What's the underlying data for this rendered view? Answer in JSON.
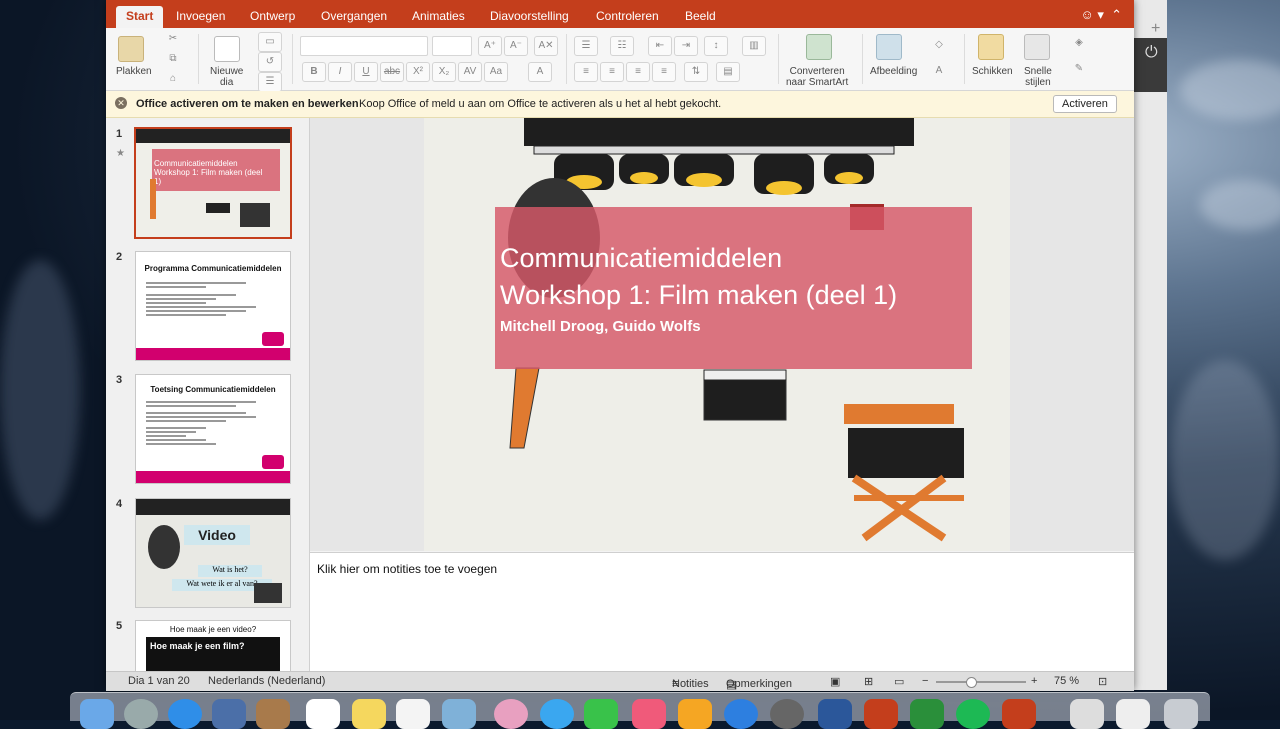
{
  "ribbon_tabs": [
    "Start",
    "Invoegen",
    "Ontwerp",
    "Overgangen",
    "Animaties",
    "Diavoorstelling",
    "Controleren",
    "Beeld"
  ],
  "ribbon": {
    "plakken": "Plakken",
    "nieuwe_dia_1": "Nieuwe",
    "nieuwe_dia_2": "dia",
    "converteren_1": "Converteren",
    "converteren_2": "naar SmartArt",
    "afbeelding": "Afbeelding",
    "schikken": "Schikken",
    "snelle_1": "Snelle",
    "snelle_2": "stijlen"
  },
  "message_bar": {
    "title": "Office activeren om te maken en bewerken",
    "text": "Koop Office of meld u aan om Office te activeren als u het al hebt gekocht.",
    "button": "Activeren"
  },
  "thumbnails": [
    {
      "num": "1",
      "title": "Communicatiemiddelen Workshop 1: Film maken (deel 1)"
    },
    {
      "num": "2",
      "title": "Programma Communicatiemiddelen"
    },
    {
      "num": "3",
      "title": "Toetsing Communicatiemiddelen"
    },
    {
      "num": "4",
      "title": "Video",
      "sub1": "Wat is het?",
      "sub2": "Wat wete ik er al van?"
    },
    {
      "num": "5",
      "title": "Hoe maak je een video?",
      "sub1": "Hoe maak je een film?"
    }
  ],
  "slide": {
    "title_line1": "Communicatiemiddelen",
    "title_line2": "Workshop 1: Film maken (deel 1)",
    "subtitle": "Mitchell Droog, Guido Wolfs"
  },
  "notes_placeholder": "Klik hier om notities toe te voegen",
  "status": {
    "slide_count": "Dia 1 van 20",
    "language": "Nederlands (Nederland)",
    "notes": "Notities",
    "comments": "Opmerkingen",
    "zoom": "75 %",
    "zoom_minus": "−",
    "zoom_plus": "+"
  },
  "colors": {
    "accent": "#c43e1c",
    "pink_box": "#d55868",
    "brand_pink": "#d2006e"
  }
}
